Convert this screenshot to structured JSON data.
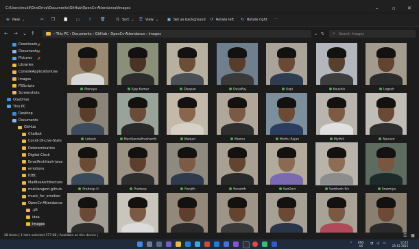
{
  "window": {
    "path_title": "C:\\Users\\mukil\\OneDrive\\Documents\\GitHub\\OpenCv-Attendance\\Images"
  },
  "toolbar": {
    "new_label": "New",
    "sort_label": "Sort",
    "view_label": "View",
    "set_bg_label": "Set as background",
    "rotate_left_label": "Rotate left",
    "rotate_right_label": "Rotate right",
    "more_label": "···"
  },
  "nav": {
    "breadcrumb": "› This PC  ›  Documents  ›  GitHub  ›  OpenCv-Attendance  ›  Images",
    "search_placeholder": "Search Images"
  },
  "sidebar": {
    "items": [
      {
        "label": "Downloads",
        "icon": "download-icon",
        "pinned": true
      },
      {
        "label": "Documents",
        "icon": "document-icon",
        "pinned": true
      },
      {
        "label": "Pictures",
        "icon": "picture-icon",
        "pinned": true
      },
      {
        "label": "Libraries",
        "icon": "folder-icon",
        "pinned": false
      },
      {
        "label": "ConsoleApplicationUse",
        "icon": "folder-icon",
        "pinned": false
      },
      {
        "label": "Images",
        "icon": "folder-icon",
        "pinned": false
      },
      {
        "label": "PSScripts",
        "icon": "folder-icon",
        "pinned": false
      },
      {
        "label": "Screenshots",
        "icon": "folder-icon",
        "pinned": false
      },
      {
        "label": "OneDrive",
        "icon": "cloud-icon",
        "pinned": false
      },
      {
        "label": "This PC",
        "icon": "pc-icon",
        "pinned": false
      },
      {
        "label": "Desktop",
        "icon": "desktop-icon",
        "pinned": false
      },
      {
        "label": "Documents",
        "icon": "document-icon",
        "pinned": false
      },
      {
        "label": "GitHub",
        "icon": "folder-icon",
        "pinned": false
      },
      {
        "label": "Chatbot",
        "icon": "folder-icon",
        "pinned": false
      },
      {
        "label": "Covid-19-Live-Stats",
        "icon": "folder-icon",
        "pinned": false
      },
      {
        "label": "Deteremination",
        "icon": "folder-icon",
        "pinned": false
      },
      {
        "label": "Digital-Clock",
        "icon": "folder-icon",
        "pinned": false
      },
      {
        "label": "EmailArchitech-Java",
        "icon": "folder-icon",
        "pinned": false
      },
      {
        "label": "emotions",
        "icon": "folder-icon",
        "pinned": false
      },
      {
        "label": "IOBC",
        "icon": "folder-icon",
        "pinned": false
      },
      {
        "label": "MailBoxArchitecture",
        "icon": "folder-icon",
        "pinned": false
      },
      {
        "label": "mukilangent.github.",
        "icon": "folder-icon",
        "pinned": false
      },
      {
        "label": "music_for_emotion",
        "icon": "folder-icon",
        "pinned": false
      },
      {
        "label": "OpenCv-Attendance",
        "icon": "folder-icon",
        "pinned": false
      },
      {
        "label": ".git",
        "icon": "folder-icon",
        "pinned": false
      },
      {
        "label": "idea",
        "icon": "folder-icon",
        "pinned": false
      },
      {
        "label": "Images",
        "icon": "folder-icon",
        "pinned": false,
        "selected": true
      }
    ]
  },
  "files": [
    {
      "name": "Abinaya"
    },
    {
      "name": "Ajay Kumar"
    },
    {
      "name": "Deepan"
    },
    {
      "name": "DevaRaj"
    },
    {
      "name": "Gopi"
    },
    {
      "name": "Koushik"
    },
    {
      "name": "Logesh"
    },
    {
      "name": "Lokesh"
    },
    {
      "name": "ManiKandaPrashanth"
    },
    {
      "name": "Manjari"
    },
    {
      "name": "Meenu"
    },
    {
      "name": "Muthu Rajan"
    },
    {
      "name": "Mythili"
    },
    {
      "name": "Naveen"
    },
    {
      "name": "Pradeep U"
    },
    {
      "name": "Pradeep"
    },
    {
      "name": "Ranjith"
    },
    {
      "name": "Revanth"
    },
    {
      "name": "SaoDevi"
    },
    {
      "name": "Santhosh Siv",
      "selected": true
    },
    {
      "name": "Sowmiya"
    },
    {
      "name": ""
    },
    {
      "name": ""
    },
    {
      "name": ""
    },
    {
      "name": ""
    },
    {
      "name": ""
    },
    {
      "name": ""
    },
    {
      "name": ""
    }
  ],
  "status": {
    "text": "28 items  |  1 item selected  377 KB  |  Available on this device  |"
  },
  "tray": {
    "lang": "ENG",
    "region": "US",
    "time": "12:42",
    "date": "25-12-2021"
  }
}
